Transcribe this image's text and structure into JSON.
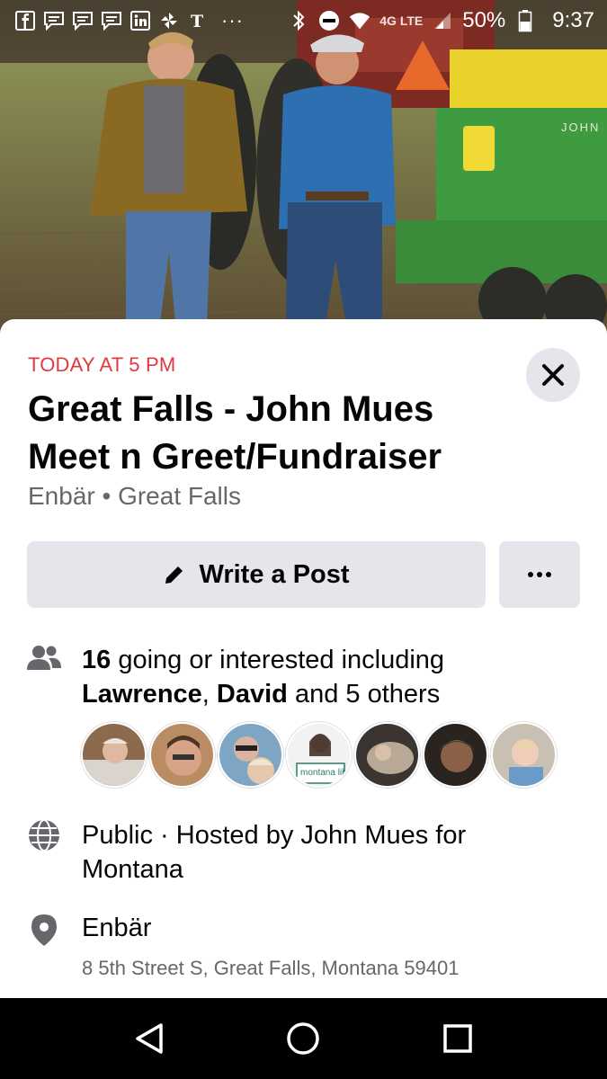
{
  "status_bar": {
    "notification_icons": [
      "facebook-icon",
      "message-icon",
      "message-icon",
      "message-icon",
      "linkedin-icon",
      "pinwheel-icon",
      "nytimes-icon"
    ],
    "overflow": "···",
    "network": "4G LTE",
    "battery_percent": "50%",
    "battery_level": 0.5,
    "time": "9:37"
  },
  "hero": {
    "tractor_brand_text": "JOHN",
    "colors": {
      "tractor_green": "#3f9b3f",
      "hopper_yellow": "#e8d22b",
      "field": "#8a8e54",
      "jacket": "#8a6a22",
      "shirt": "#2d6fb0"
    }
  },
  "event": {
    "date_label": "TODAY AT 5 PM",
    "title": "Great Falls - John Mues Meet n Greet/Fundraiser",
    "subtitle": "Enbär • Great Falls",
    "write_post_label": "Write a Post",
    "more_label": "···",
    "going_count": "16",
    "going_text": " going or interested including",
    "friend_1": "Lawrence",
    "separator": ", ",
    "friend_2": "David",
    "others_text": " and 5 others",
    "attendee_avatars": 7,
    "privacy_host": "Public · Hosted by John Mues for Montana",
    "venue_name": "Enbär",
    "address": "8 5th Street S, Great Falls, Montana 59401",
    "avatar_4_text": "montana libraries"
  },
  "colors": {
    "date_red": "#e0393e",
    "button_grey": "#e4e6eb",
    "secondary_text": "#65676b",
    "primary_text": "#050505"
  },
  "nav": [
    "back-icon",
    "home-icon",
    "recents-icon"
  ]
}
